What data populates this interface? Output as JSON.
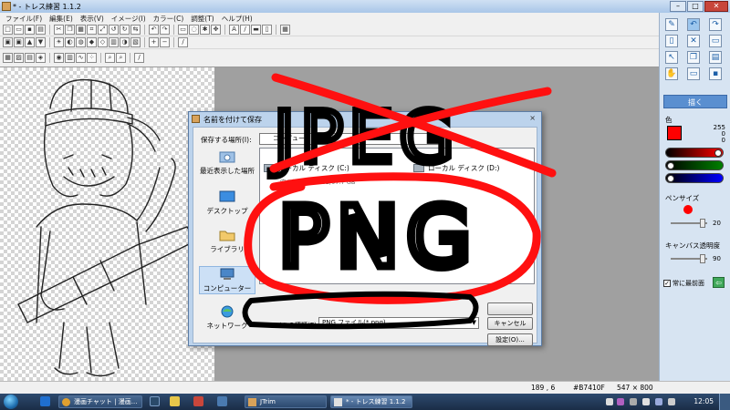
{
  "window": {
    "title": "* - トレス練習 1.1.2",
    "buttons": [
      "–",
      "□",
      "✕"
    ]
  },
  "menu": [
    "ファイル(F)",
    "編集(E)",
    "表示(V)",
    "イメージ(I)",
    "カラー(C)",
    "調整(T)",
    "ヘルプ(H)"
  ],
  "right_panel": {
    "draw_button": "描く",
    "color_label": "色",
    "color_hex": "#ff0000",
    "rgb": [
      "255",
      "0",
      "0"
    ],
    "pen_size_label": "ペンサイズ",
    "pen_size_value": "20",
    "canvas_opacity_label": "キャンバス透明度",
    "canvas_opacity_value": "90",
    "bring_front_label": "常に最前面",
    "bring_front_checked": "✓"
  },
  "status_bar": {
    "coords": "189 , 6",
    "color_code": "#B7410F",
    "image_size": "547 × 800"
  },
  "dialog": {
    "title": "名前を付けて保存",
    "close": "×",
    "save_in_label": "保存する場所(I):",
    "places": [
      "最近表示した場所",
      "デスクトップ",
      "ライブラリ",
      "コンピューター",
      "ネットワーク"
    ],
    "location_text": "コンピューター",
    "files": [
      {
        "name": "ローカル ディスク (C:)",
        "detail": "空き領域 64.5 GB/97.7 GB"
      },
      {
        "name": "ローカル ディスク (D:)",
        "detail": ""
      }
    ],
    "file_type_label": "ファイルの種類(T):",
    "file_type_value": "PNG ファイル(*.png)",
    "cancel_button": "キャンセル",
    "settings_button": "設定(O)..."
  },
  "annotations": {
    "struck_text": "JPEG",
    "circled_text": "PNG"
  },
  "taskbar": {
    "items": [
      "漫画チャット | 漫画...",
      "JTrim",
      "* - トレス練習 1.1.2"
    ],
    "clock": "12:05"
  },
  "colors": {
    "accent": "#5a8fd0",
    "annotation_red": "#ff1010",
    "annotation_black": "#000000"
  }
}
